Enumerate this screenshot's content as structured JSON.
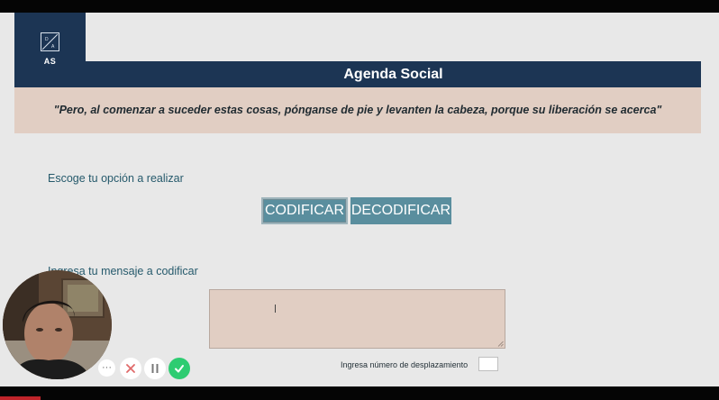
{
  "header": {
    "logo_text": "AS",
    "title": "Agenda Social"
  },
  "quote": "\"Pero, al comenzar a suceder estas cosas, pónganse de pie y levanten la cabeza, porque su liberación se acerca\"",
  "options": {
    "label": "Escoge tu opción a realizar",
    "encode_label": "CODIFICAR",
    "decode_label": "DECODIFICAR"
  },
  "message": {
    "label": "Ingresa tu mensaje a codificar",
    "value": ""
  },
  "shift": {
    "label": "Ingresa número de desplazamiento",
    "value": ""
  },
  "recorder": {
    "more_glyph": "···"
  },
  "colors": {
    "navy": "#1c3554",
    "beige": "#e1cec3",
    "teal_button": "#5a8e9e",
    "label_teal": "#265a6c",
    "done_green": "#2ecc71"
  }
}
